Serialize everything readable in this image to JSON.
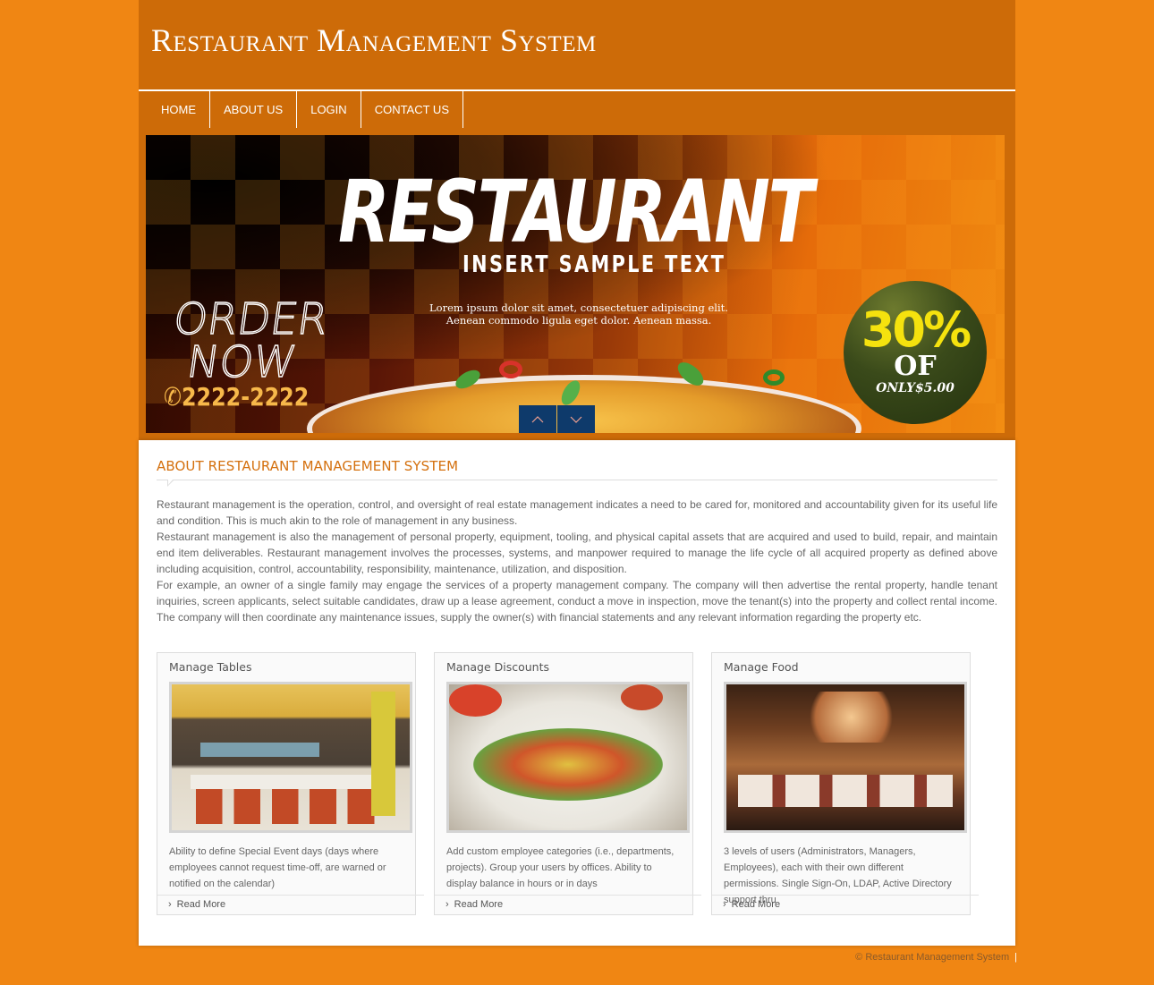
{
  "header": {
    "site_title": "Restaurant Management System"
  },
  "nav": {
    "items": [
      {
        "label": "HOME"
      },
      {
        "label": "ABOUT US"
      },
      {
        "label": "LOGIN"
      },
      {
        "label": "CONTACT US"
      }
    ]
  },
  "banner": {
    "title": "RESTAURANT",
    "subtitle": "INSERT SAMPLE TEXT",
    "lorem_line1": "Lorem ipsum dolor sit amet, consectetuer adipiscing elit.",
    "lorem_line2": "Aenean commodo ligula eget dolor. Aenean massa.",
    "order_line1": "ORDER",
    "order_line2": "NOW",
    "phone": "2222-2222",
    "badge_percent": "30%",
    "badge_of": "OF",
    "badge_price": "ONLY$5.00",
    "prev_icon": "chevron-up-icon",
    "next_icon": "chevron-down-icon",
    "nav_color": "#0e3a6b"
  },
  "about": {
    "title": "ABOUT RESTAURANT MANAGEMENT SYSTEM",
    "paragraphs": [
      "Restaurant management is the operation, control, and oversight of real estate management indicates a need to be cared for, monitored and accountability given for its useful life and condition. This is much akin to the role of management in any business.",
      "Restaurant management is also the management of personal property, equipment, tooling, and physical capital assets that are acquired and used to build, repair, and maintain end item deliverables. Restaurant management involves the processes, systems, and manpower required to manage the life cycle of all acquired property as defined above including acquisition, control, accountability, responsibility, maintenance, utilization, and disposition.",
      "For example, an owner of a single family may engage the services of a property management company. The company will then advertise the rental property, handle tenant inquiries, screen applicants, select suitable candidates, draw up a lease agreement, conduct a move in inspection, move the tenant(s) into the property and collect rental income. The company will then coordinate any maintenance issues, supply the owner(s) with financial statements and any relevant information regarding the property etc."
    ]
  },
  "cards": [
    {
      "title": "Manage Tables",
      "image": "restaurant-dining-room-photo",
      "description": "Ability to define Special Event days (days where employees cannot request time-off, are warned or notified on the calendar)",
      "link": "Read More"
    },
    {
      "title": "Manage Discounts",
      "image": "food-skewers-photo",
      "description": "Add custom employee categories (i.e., departments, projects). Group your users by offices. Ability to display balance in hours or in days",
      "link": "Read More"
    },
    {
      "title": "Manage Food",
      "image": "restaurant-interior-photo",
      "description": "3 levels of users (Administrators, Managers, Employees), each with their own different permissions. Single Sign-On, LDAP, Active Directory support thru",
      "link": "Read More"
    }
  ],
  "footer": {
    "copyright": "© Restaurant Management System",
    "separator": "|"
  },
  "colors": {
    "page_background": "#f08613",
    "header_background": "#cd6b08",
    "accent_title": "#d4700e",
    "slider_nav": "#0e3a6b"
  }
}
